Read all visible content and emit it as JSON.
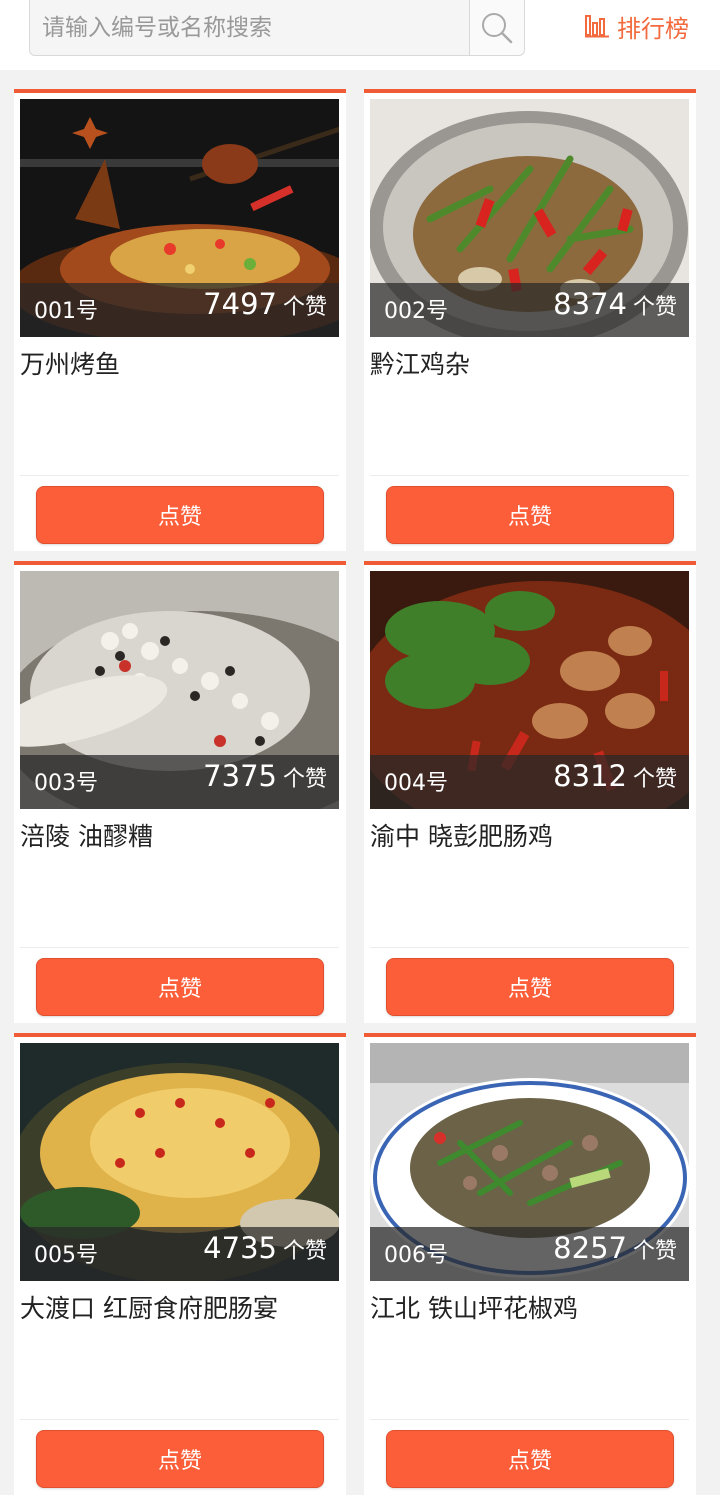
{
  "search": {
    "placeholder": "请输入编号或名称搜索"
  },
  "rank": {
    "label": "排行榜"
  },
  "like_unit": "个赞",
  "like_button": "点赞",
  "items": [
    {
      "num": "001号",
      "count": "7497",
      "name": "万州烤鱼"
    },
    {
      "num": "002号",
      "count": "8374",
      "name": "黔江鸡杂"
    },
    {
      "num": "003号",
      "count": "7375",
      "name": "涪陵 油醪糟"
    },
    {
      "num": "004号",
      "count": "8312",
      "name": "渝中 晓彭肥肠鸡"
    },
    {
      "num": "005号",
      "count": "4735",
      "name": "大渡口 红厨食府肥肠宴"
    },
    {
      "num": "006号",
      "count": "8257",
      "name": "江北 铁山坪花椒鸡"
    }
  ],
  "colors": {
    "accent": "#fd5e3a",
    "border": "#f05a35",
    "rank": "#f26a3d"
  }
}
